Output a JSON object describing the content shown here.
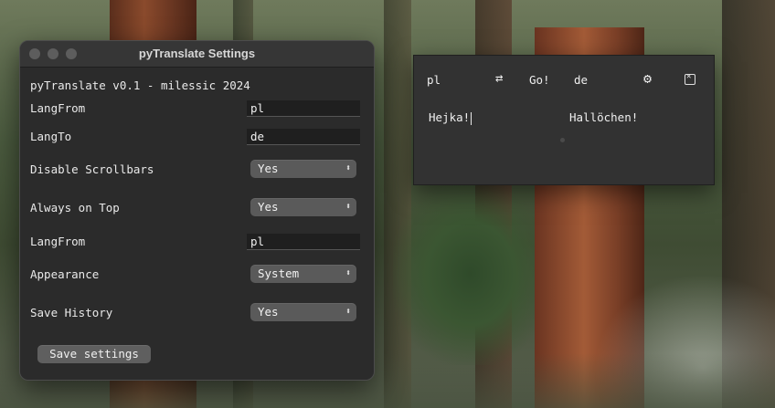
{
  "settings_window": {
    "title": "pyTranslate Settings",
    "header": "pyTranslate v0.1 - milessic 2024",
    "rows": [
      {
        "label": "LangFrom",
        "value": "pl"
      },
      {
        "label": "LangTo",
        "value": "de"
      },
      {
        "label": "Disable Scrollbars",
        "value": "Yes"
      },
      {
        "label": "Always on Top",
        "value": "Yes"
      },
      {
        "label": "LangFrom",
        "value": "pl"
      },
      {
        "label": "Appearance",
        "value": "System"
      },
      {
        "label": "Save History",
        "value": "Yes"
      }
    ],
    "save_button": "Save settings"
  },
  "translator_window": {
    "lang_from": "pl",
    "swap_icon": "swap-arrows-icon",
    "go_label": "Go!",
    "lang_to": "de",
    "settings_icon": "gear-icon",
    "close_icon": "close-box-icon",
    "input_text": "Hejka!",
    "output_text": "Hallöchen!"
  }
}
